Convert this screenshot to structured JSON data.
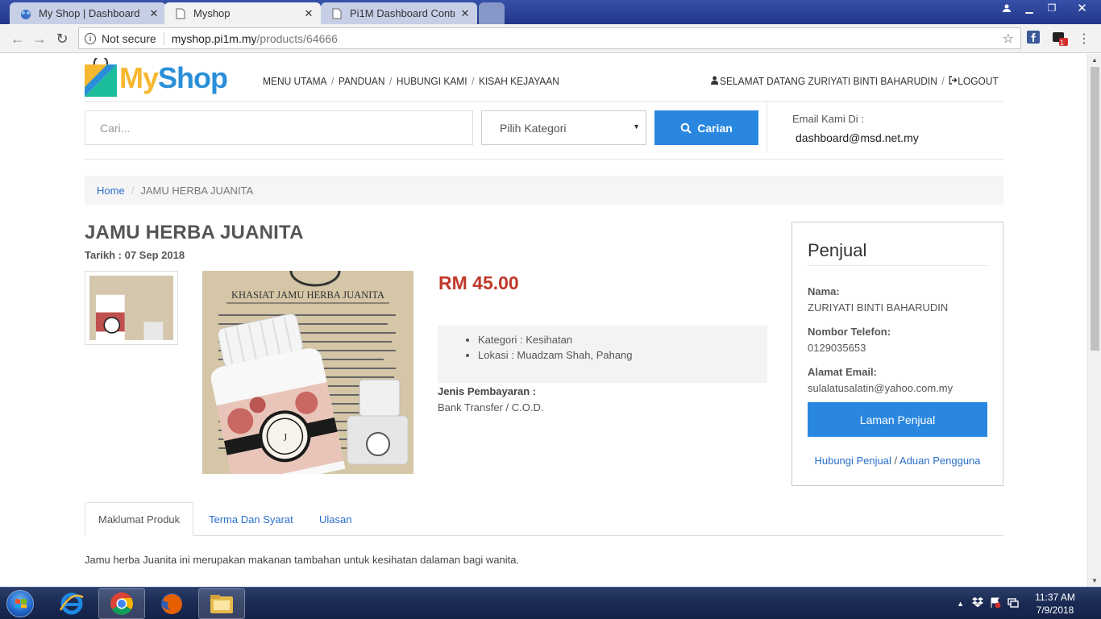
{
  "browser": {
    "tabs": [
      {
        "title": "My Shop | Dashboard",
        "active": false
      },
      {
        "title": "Myshop",
        "active": true
      },
      {
        "title": "Pi1M Dashboard Control",
        "active": false
      }
    ],
    "omnibox": {
      "security": "Not secure",
      "host": "myshop.pi1m.my",
      "path": "/products/64666"
    },
    "ext_badge": "1"
  },
  "site": {
    "logo": {
      "part1": "My",
      "part2": "Shop"
    },
    "nav": [
      "MENU UTAMA",
      "PANDUAN",
      "HUBUNGI KAMI",
      "KISAH KEJAYAAN"
    ],
    "nav_sep": "/",
    "welcome": "SELAMAT DATANG ZURIYATI BINTI BAHARUDIN",
    "logout": "LOGOUT",
    "search": {
      "placeholder": "Cari...",
      "category": "Pilih Kategori",
      "button": "Carian"
    },
    "email_label": "Email Kami Di :",
    "email": "dashboard@msd.net.my"
  },
  "breadcrumb": {
    "home": "Home",
    "sep": "/",
    "current": "JAMU HERBA JUANITA"
  },
  "product": {
    "title": "JAMU HERBA JUANITA",
    "date": "Tarikh : 07 Sep 2018",
    "image_text": "KHASIAT JAMU HERBA JUANITA",
    "price": "RM 45.00",
    "kategori": "Kategori : Kesihatan",
    "lokasi": "Lokasi : Muadzam Shah, Pahang",
    "payment_label": "Jenis Pembayaran :",
    "payment_value": "Bank Transfer / C.O.D.",
    "tabs": [
      "Maklumat Produk",
      "Terma Dan Syarat",
      "Ulasan"
    ],
    "description": "Jamu herba Juanita ini merupakan makanan tambahan untuk kesihatan dalaman bagi wanita."
  },
  "seller": {
    "heading": "Penjual",
    "name_label": "Nama:",
    "name": "ZURIYATI BINTI BAHARUDIN",
    "phone_label": "Nombor Telefon:",
    "phone": "0129035653",
    "email_label": "Alamat Email:",
    "email": "sulalatusalatin@yahoo.com.my",
    "button": "Laman Penjual",
    "link1": "Hubungi Penjual",
    "link_sep": "/",
    "link2": "Aduan Pengguna"
  },
  "taskbar": {
    "time": "11:37 AM",
    "date": "7/9/2018"
  },
  "colors": {
    "accent": "#2a87e0",
    "price": "#c0392b",
    "link": "#2a6fcb"
  }
}
